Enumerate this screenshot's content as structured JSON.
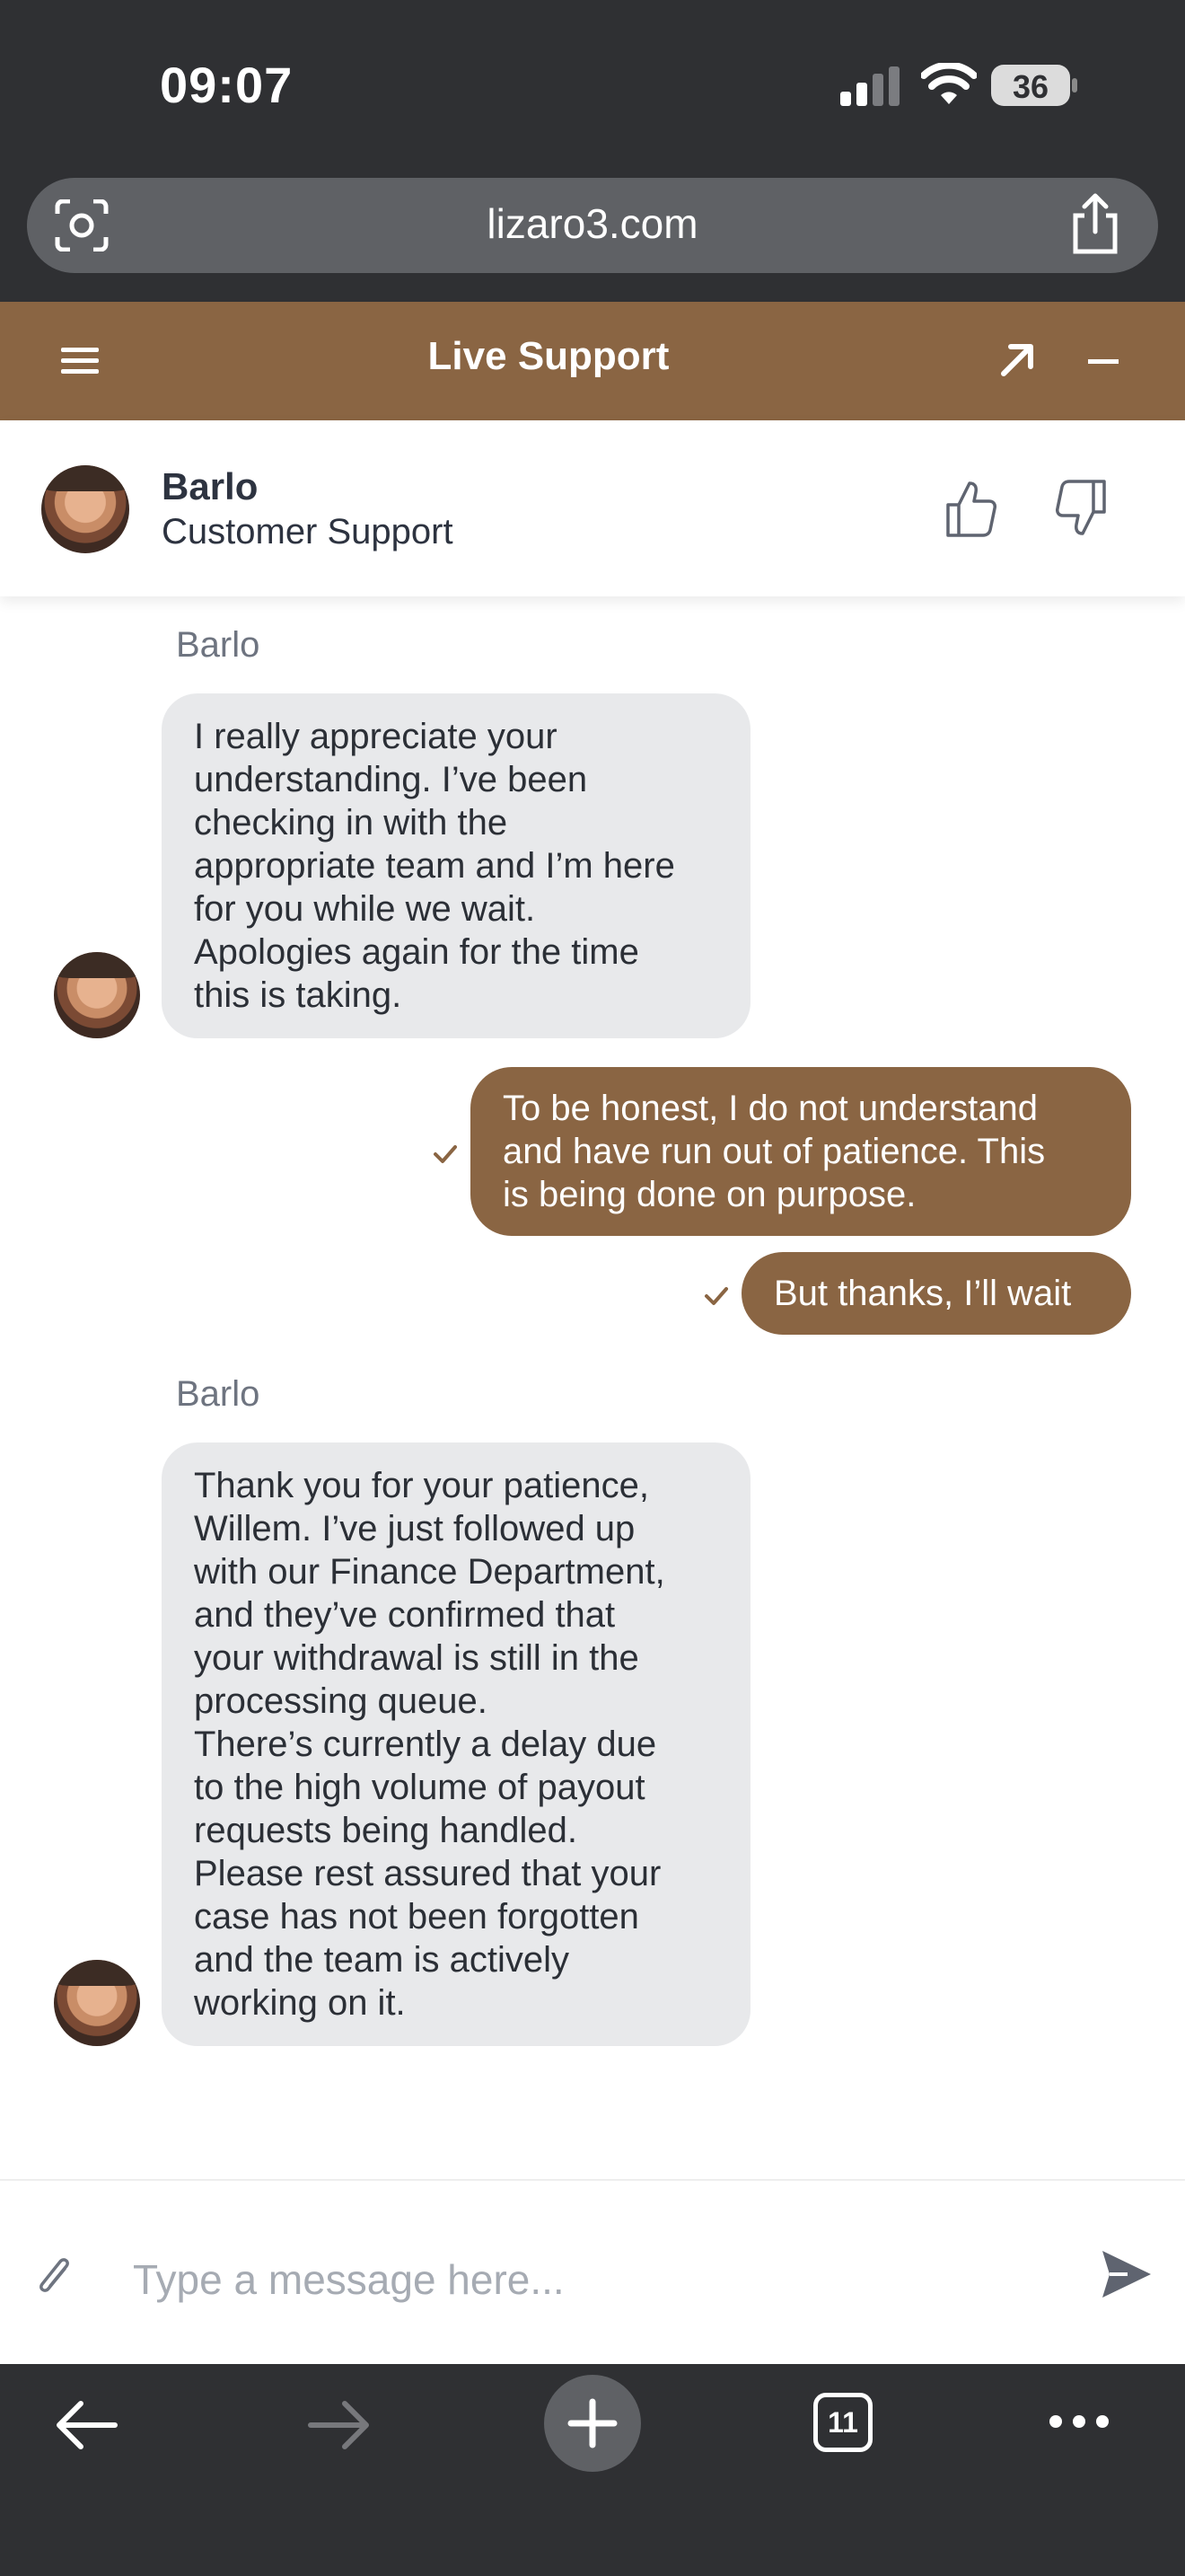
{
  "status_bar": {
    "time": "09:07",
    "battery": "36"
  },
  "browser": {
    "url": "lizaro3.com",
    "tab_count": "11"
  },
  "chat": {
    "title": "Live Support",
    "agent": {
      "name": "Barlo",
      "role": "Customer Support"
    },
    "messages": [
      {
        "sender": "Barlo",
        "lines": [
          "I really appreciate your",
          "understanding. I’ve been",
          "checking in with the",
          "appropriate team and I’m here",
          "for you while we wait.",
          "Apologies again for the time",
          "this is taking."
        ]
      },
      {
        "lines": [
          "To be honest, I do not understand",
          "and have run out of patience. This",
          "is being done on purpose."
        ]
      },
      {
        "lines": [
          "But thanks, I’ll wait"
        ]
      },
      {
        "sender": "Barlo",
        "lines": [
          "Thank you for your patience,",
          "Willem. I’ve just followed up",
          "with our Finance Department,",
          "and they’ve confirmed that",
          "your withdrawal is still in the",
          "processing queue.",
          "There’s currently a delay due",
          "to the high volume of payout",
          "requests being handled.",
          "Please rest assured that your",
          "case has not been forgotten",
          "and the team is actively",
          "working on it."
        ]
      }
    ],
    "input_placeholder": "Type a message here..."
  },
  "colors": {
    "brand": "#8a6543",
    "chrome": "#2f3033",
    "incoming_bubble": "#e8e9eb"
  },
  "icons": [
    "lens-icon",
    "share-icon",
    "menu-icon",
    "expand-icon",
    "minimize-icon",
    "thumb-up-icon",
    "thumb-down-icon",
    "check-icon",
    "attach-icon",
    "send-icon",
    "back-icon",
    "forward-icon",
    "plus-icon",
    "more-icon"
  ]
}
